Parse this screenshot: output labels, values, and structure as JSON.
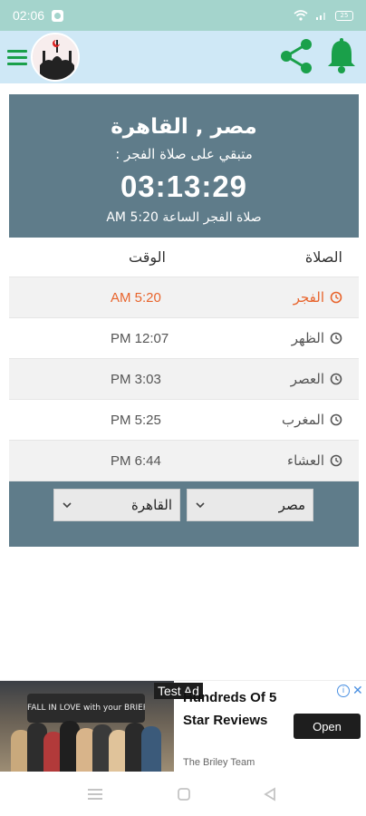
{
  "status_bar": {
    "time": "02:06",
    "battery_level": "25"
  },
  "app_bar": {
    "menu_icon": "menu-icon",
    "logo_icon": "mosque-logo-icon",
    "share_icon": "share-icon",
    "bell_icon": "bell-icon",
    "accent_color": "#1aa04a",
    "background_color": "#cfe8f6"
  },
  "header": {
    "location": "مصر , القاهرة",
    "remaining_label": "متبقي على صلاة الفجر :",
    "countdown": "03:13:29",
    "next_prayer_text": "صلاة الفجر الساعة 5:20 AM",
    "background_color": "#5f7c8a"
  },
  "table": {
    "col_prayer": "الصلاة",
    "col_time": "الوقت",
    "rows": [
      {
        "name": "الفجر",
        "time": "AM  5:20",
        "active": true
      },
      {
        "name": "الظهر",
        "time": "PM  12:07",
        "active": false
      },
      {
        "name": "العصر",
        "time": "PM  3:03",
        "active": false
      },
      {
        "name": "المغرب",
        "time": "PM  5:25",
        "active": false
      },
      {
        "name": "العشاء",
        "time": "PM  6:44",
        "active": false
      }
    ],
    "active_color": "#e8642c"
  },
  "selectors": {
    "country": "مصر",
    "city": "القاهرة"
  },
  "ad": {
    "tag": "Test Ad",
    "title": "Hundreds Of 5 Star Reviews",
    "advertiser": "The Briley Team",
    "cta": "Open",
    "image_sign_text": "FALL IN LOVE with your BRIER?"
  },
  "nav_bar": {
    "recents_icon": "recents-icon",
    "home_icon": "home-icon",
    "back_icon": "back-icon"
  }
}
